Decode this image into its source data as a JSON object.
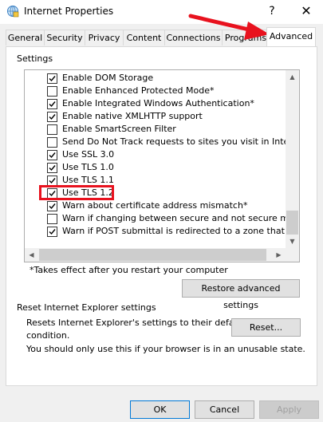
{
  "window": {
    "title": "Internet Properties",
    "help_glyph": "?",
    "close_glyph": "✕"
  },
  "tabs": [
    {
      "label": "General"
    },
    {
      "label": "Security"
    },
    {
      "label": "Privacy"
    },
    {
      "label": "Content"
    },
    {
      "label": "Connections"
    },
    {
      "label": "Programs"
    },
    {
      "label": "Advanced",
      "active": true
    }
  ],
  "settings": {
    "group_label": "Settings",
    "items": [
      {
        "label": "Enable DOM Storage",
        "checked": true
      },
      {
        "label": "Enable Enhanced Protected Mode*",
        "checked": false
      },
      {
        "label": "Enable Integrated Windows Authentication*",
        "checked": true
      },
      {
        "label": "Enable native XMLHTTP support",
        "checked": true
      },
      {
        "label": "Enable SmartScreen Filter",
        "checked": false
      },
      {
        "label": "Send Do Not Track requests to sites you visit in Internet E",
        "checked": false
      },
      {
        "label": "Use SSL 3.0",
        "checked": true
      },
      {
        "label": "Use TLS 1.0",
        "checked": true
      },
      {
        "label": "Use TLS 1.1",
        "checked": true
      },
      {
        "label": "Use TLS 1.2",
        "checked": true
      },
      {
        "label": "Warn about certificate address mismatch*",
        "checked": true
      },
      {
        "label": "Warn if changing between secure and not secure mode",
        "checked": false
      },
      {
        "label": "Warn if POST submittal is redirected to a zone that does n",
        "checked": true
      }
    ],
    "restart_note": "*Takes effect after you restart your computer",
    "restore_button": "Restore advanced settings"
  },
  "reset": {
    "group_label": "Reset Internet Explorer settings",
    "description_line1": "Resets Internet Explorer's settings to their default",
    "description_line2": "condition.",
    "reset_button": "Reset...",
    "warning": "You should only use this if your browser is in an unusable state."
  },
  "footer": {
    "ok": "OK",
    "cancel": "Cancel",
    "apply": "Apply"
  },
  "colors": {
    "annotation_red": "#e8121e",
    "focus_blue": "#0078d7"
  }
}
